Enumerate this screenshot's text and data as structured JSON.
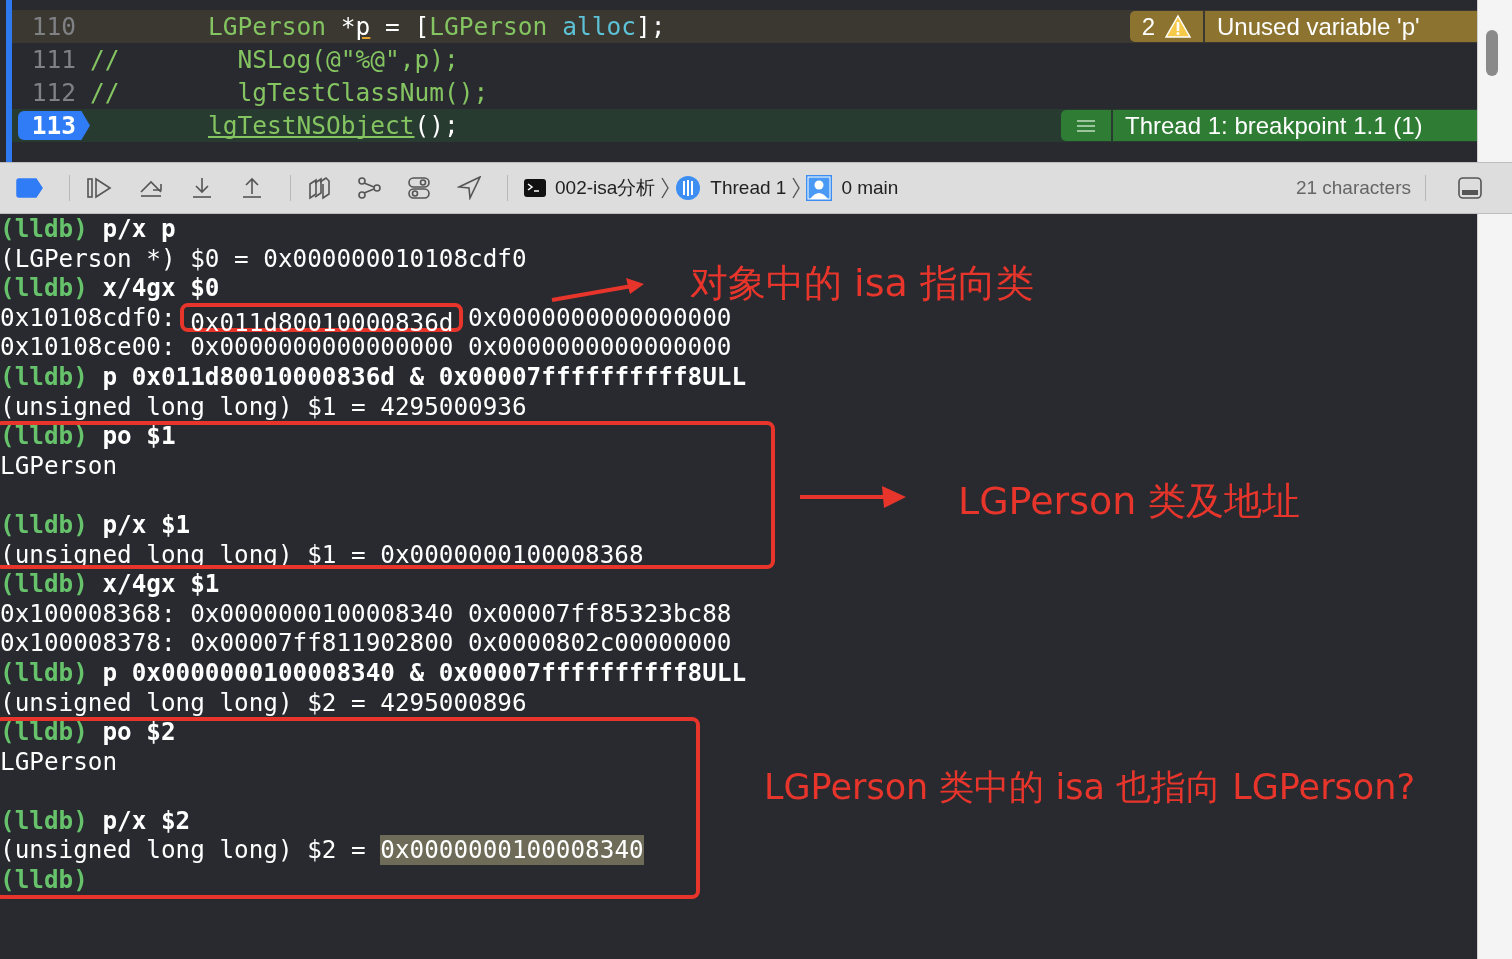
{
  "editor": {
    "lines": [
      {
        "number": "110",
        "kind": "warning",
        "segments": [
          {
            "text": "        LGPerson",
            "kind": "type"
          },
          {
            "text": " *",
            "kind": "plain"
          },
          {
            "text": "p",
            "kind": "flagged"
          },
          {
            "text": " = [",
            "kind": "plain"
          },
          {
            "text": "LGPerson",
            "kind": "type"
          },
          {
            "text": " alloc",
            "kind": "method"
          },
          {
            "text": "];",
            "kind": "plain"
          }
        ],
        "badge": {
          "count": "2",
          "message": "Unused variable 'p'"
        }
      },
      {
        "number": "111",
        "kind": "normal",
        "segments": [
          {
            "text": "//        NSLog(@\"%@\",p);",
            "kind": "comment"
          }
        ]
      },
      {
        "number": "112",
        "kind": "normal",
        "segments": [
          {
            "text": "//        lgTestClassNum();",
            "kind": "comment"
          }
        ]
      },
      {
        "number": "113",
        "kind": "current",
        "segments": [
          {
            "text": "        lgTestNSObject",
            "kind": "link"
          },
          {
            "text": "();",
            "kind": "plain"
          }
        ],
        "badge": {
          "message": "Thread 1: breakpoint 1.1 (1)"
        }
      }
    ]
  },
  "debug_bar": {
    "breakpoints_active": true,
    "breadcrumbs": [
      {
        "kind": "process",
        "label": "002-isa分析"
      },
      {
        "kind": "thread",
        "label": "Thread 1"
      },
      {
        "kind": "frame",
        "label": "0 main"
      }
    ],
    "character_count": "21 characters"
  },
  "console": {
    "lines": [
      {
        "kind": "command",
        "prompt": "(lldb)",
        "text": "p/x p"
      },
      {
        "kind": "output",
        "text": "(LGPerson *) $0 = 0x000000010108cdf0"
      },
      {
        "kind": "command",
        "prompt": "(lldb)",
        "text": "x/4gx $0"
      },
      {
        "kind": "output",
        "text": "0x10108cdf0: ",
        "boxed_text": "0x011d80010000836d",
        "after_text": " 0x0000000000000000"
      },
      {
        "kind": "output",
        "text": "0x10108ce00: 0x0000000000000000 0x0000000000000000"
      },
      {
        "kind": "command",
        "prompt": "(lldb)",
        "text": "p 0x011d80010000836d & 0x00007ffffffffff8ULL"
      },
      {
        "kind": "output",
        "text": "(unsigned long long) $1 = 4295000936"
      },
      {
        "kind": "command",
        "prompt": "(lldb)",
        "text": "po $1"
      },
      {
        "kind": "output",
        "text": "LGPerson"
      },
      {
        "kind": "blank"
      },
      {
        "kind": "command",
        "prompt": "(lldb)",
        "text": "p/x $1"
      },
      {
        "kind": "output",
        "text": "(unsigned long long) $1 = 0x0000000100008368"
      },
      {
        "kind": "command",
        "prompt": "(lldb)",
        "text": "x/4gx $1"
      },
      {
        "kind": "output",
        "text": "0x100008368: 0x0000000100008340 0x00007ff85323bc88"
      },
      {
        "kind": "output",
        "text": "0x100008378: 0x00007ff811902800 0x0000802c00000000"
      },
      {
        "kind": "command",
        "prompt": "(lldb)",
        "text": "p 0x0000000100008340 & 0x00007ffffffffff8ULL"
      },
      {
        "kind": "output",
        "text": "(unsigned long long) $2 = 4295000896"
      },
      {
        "kind": "command",
        "prompt": "(lldb)",
        "text": "po $2"
      },
      {
        "kind": "output",
        "text": "LGPerson"
      },
      {
        "kind": "blank"
      },
      {
        "kind": "command",
        "prompt": "(lldb)",
        "text": "p/x $2"
      },
      {
        "kind": "output",
        "text": "(unsigned long long) $2 = ",
        "selected_text": "0x0000000100008340"
      },
      {
        "kind": "command",
        "prompt": "(lldb)"
      }
    ]
  },
  "annotations": [
    {
      "text": "对象中的 isa 指向类"
    },
    {
      "text": "LGPerson 类及地址"
    },
    {
      "text": "LGPerson 类中的 isa 也指向 LGPerson?"
    }
  ]
}
